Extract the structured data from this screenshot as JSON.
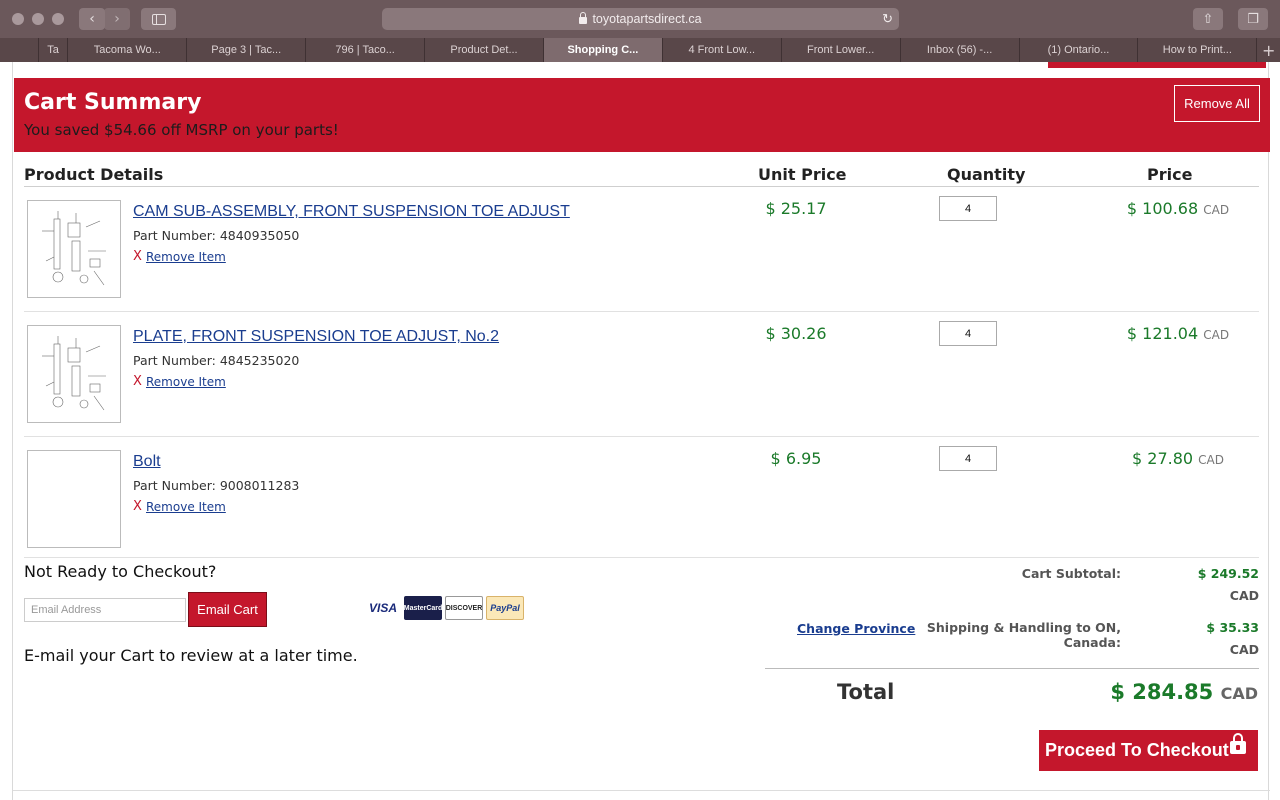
{
  "browser": {
    "url": "toyotapartsdirect.ca",
    "tabs": [
      {
        "label": "Ta",
        "active": false
      },
      {
        "label": "Tacoma Wo...",
        "active": false
      },
      {
        "label": "Page 3 | Tac...",
        "active": false
      },
      {
        "label": "796 | Taco...",
        "active": false
      },
      {
        "label": "Product Det...",
        "active": false
      },
      {
        "label": "Shopping C...",
        "active": true
      },
      {
        "label": "4 Front Low...",
        "active": false
      },
      {
        "label": "Front Lower...",
        "active": false
      },
      {
        "label": "Inbox (56) -...",
        "active": false
      },
      {
        "label": "(1) Ontario...",
        "active": false
      },
      {
        "label": "How to Print...",
        "active": false
      }
    ]
  },
  "summary": {
    "title": "Cart Summary",
    "saved": "You saved $54.66 off MSRP on your parts!",
    "remove_all": "Remove All"
  },
  "columns": {
    "product": "Product Details",
    "unit_price": "Unit Price",
    "quantity": "Quantity",
    "price": "Price"
  },
  "items": [
    {
      "name": "CAM SUB-ASSEMBLY, FRONT SUSPENSION TOE ADJUST",
      "part_number": "Part Number: 4840935050",
      "remove_x": "X",
      "remove": "Remove Item",
      "unit_price": "$ 25.17",
      "quantity": "4",
      "price": "$ 100.68",
      "currency": "CAD"
    },
    {
      "name": "PLATE, FRONT SUSPENSION TOE ADJUST, No.2",
      "part_number": "Part Number: 4845235020",
      "remove_x": "X",
      "remove": "Remove Item",
      "unit_price": "$ 30.26",
      "quantity": "4",
      "price": "$ 121.04",
      "currency": "CAD"
    },
    {
      "name": "Bolt",
      "part_number": "Part Number: 9008011283",
      "remove_x": "X",
      "remove": "Remove Item",
      "unit_price": "$ 6.95",
      "quantity": "4",
      "price": "$ 27.80",
      "currency": "CAD"
    }
  ],
  "save_cart": {
    "heading": "Not Ready to Checkout?",
    "email_placeholder": "Email Address",
    "button": "Email Cart",
    "message": "E-mail your Cart to review at a later time."
  },
  "payment_cards": {
    "visa": "VISA",
    "mastercard": "MasterCard",
    "discover": "DISCOVER",
    "paypal": "PayPal"
  },
  "totals": {
    "subtotal_label": "Cart Subtotal:",
    "subtotal": "$ 249.52",
    "subtotal_currency": "CAD",
    "change_province": "Change Province",
    "shipping_label": "Shipping & Handling to ON, Canada:",
    "shipping": "$ 35.33",
    "shipping_currency": "CAD",
    "total_label": "Total",
    "total": "$ 284.85",
    "total_currency": "CAD"
  },
  "checkout": {
    "label": "Proceed To Checkout"
  }
}
